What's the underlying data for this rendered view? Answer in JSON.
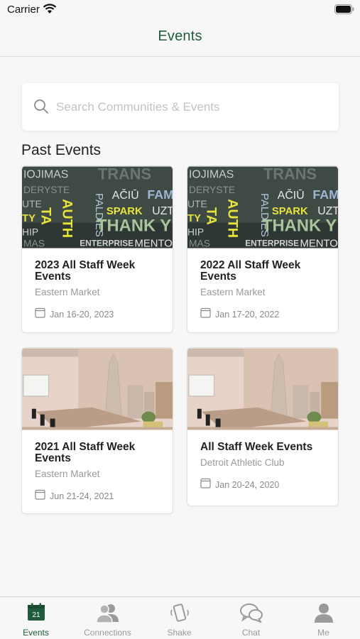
{
  "status_bar": {
    "carrier": "Carrier"
  },
  "header": {
    "title": "Events"
  },
  "search": {
    "placeholder": "Search Communities & Events",
    "value": ""
  },
  "section": {
    "title": "Past Events"
  },
  "events": [
    {
      "title": "2023 All Staff Week Events",
      "venue": "Eastern Market",
      "date": "Jan 16-20, 2023",
      "image": "words-wall"
    },
    {
      "title": "2022 All Staff Week Events",
      "venue": "Eastern Market",
      "date": "Jan 17-20, 2022",
      "image": "words-wall"
    },
    {
      "title": "2021 All Staff Week Events",
      "venue": "Eastern Market",
      "date": "Jun 21-24, 2021",
      "image": "conference-room"
    },
    {
      "title": "All Staff Week Events",
      "venue": "Detroit Athletic Club",
      "date": "Jan 20-24, 2020",
      "image": "conference-room"
    }
  ],
  "image_words": [
    "IOJIMAS",
    "TRANS",
    "DERYSTE",
    "PALDIES",
    "AČIŪ",
    "FAM",
    "UTE",
    "TA",
    "AUTH",
    "SPARK",
    "UZT",
    "TY",
    "THANK Y",
    "HIP",
    "MAS",
    "ENTERPRISE",
    "MENTO"
  ],
  "tab_bar": {
    "items": [
      {
        "label": "Events",
        "icon": "calendar-icon",
        "active": true,
        "badge": "21"
      },
      {
        "label": "Connections",
        "icon": "people-icon",
        "active": false
      },
      {
        "label": "Shake",
        "icon": "phone-shake-icon",
        "active": false
      },
      {
        "label": "Chat",
        "icon": "chat-bubbles-icon",
        "active": false
      },
      {
        "label": "Me",
        "icon": "person-icon",
        "active": false
      }
    ]
  },
  "colors": {
    "accent": "#1f5b3c",
    "inactive": "#9a9a9a",
    "background": "#f7f7f7"
  }
}
